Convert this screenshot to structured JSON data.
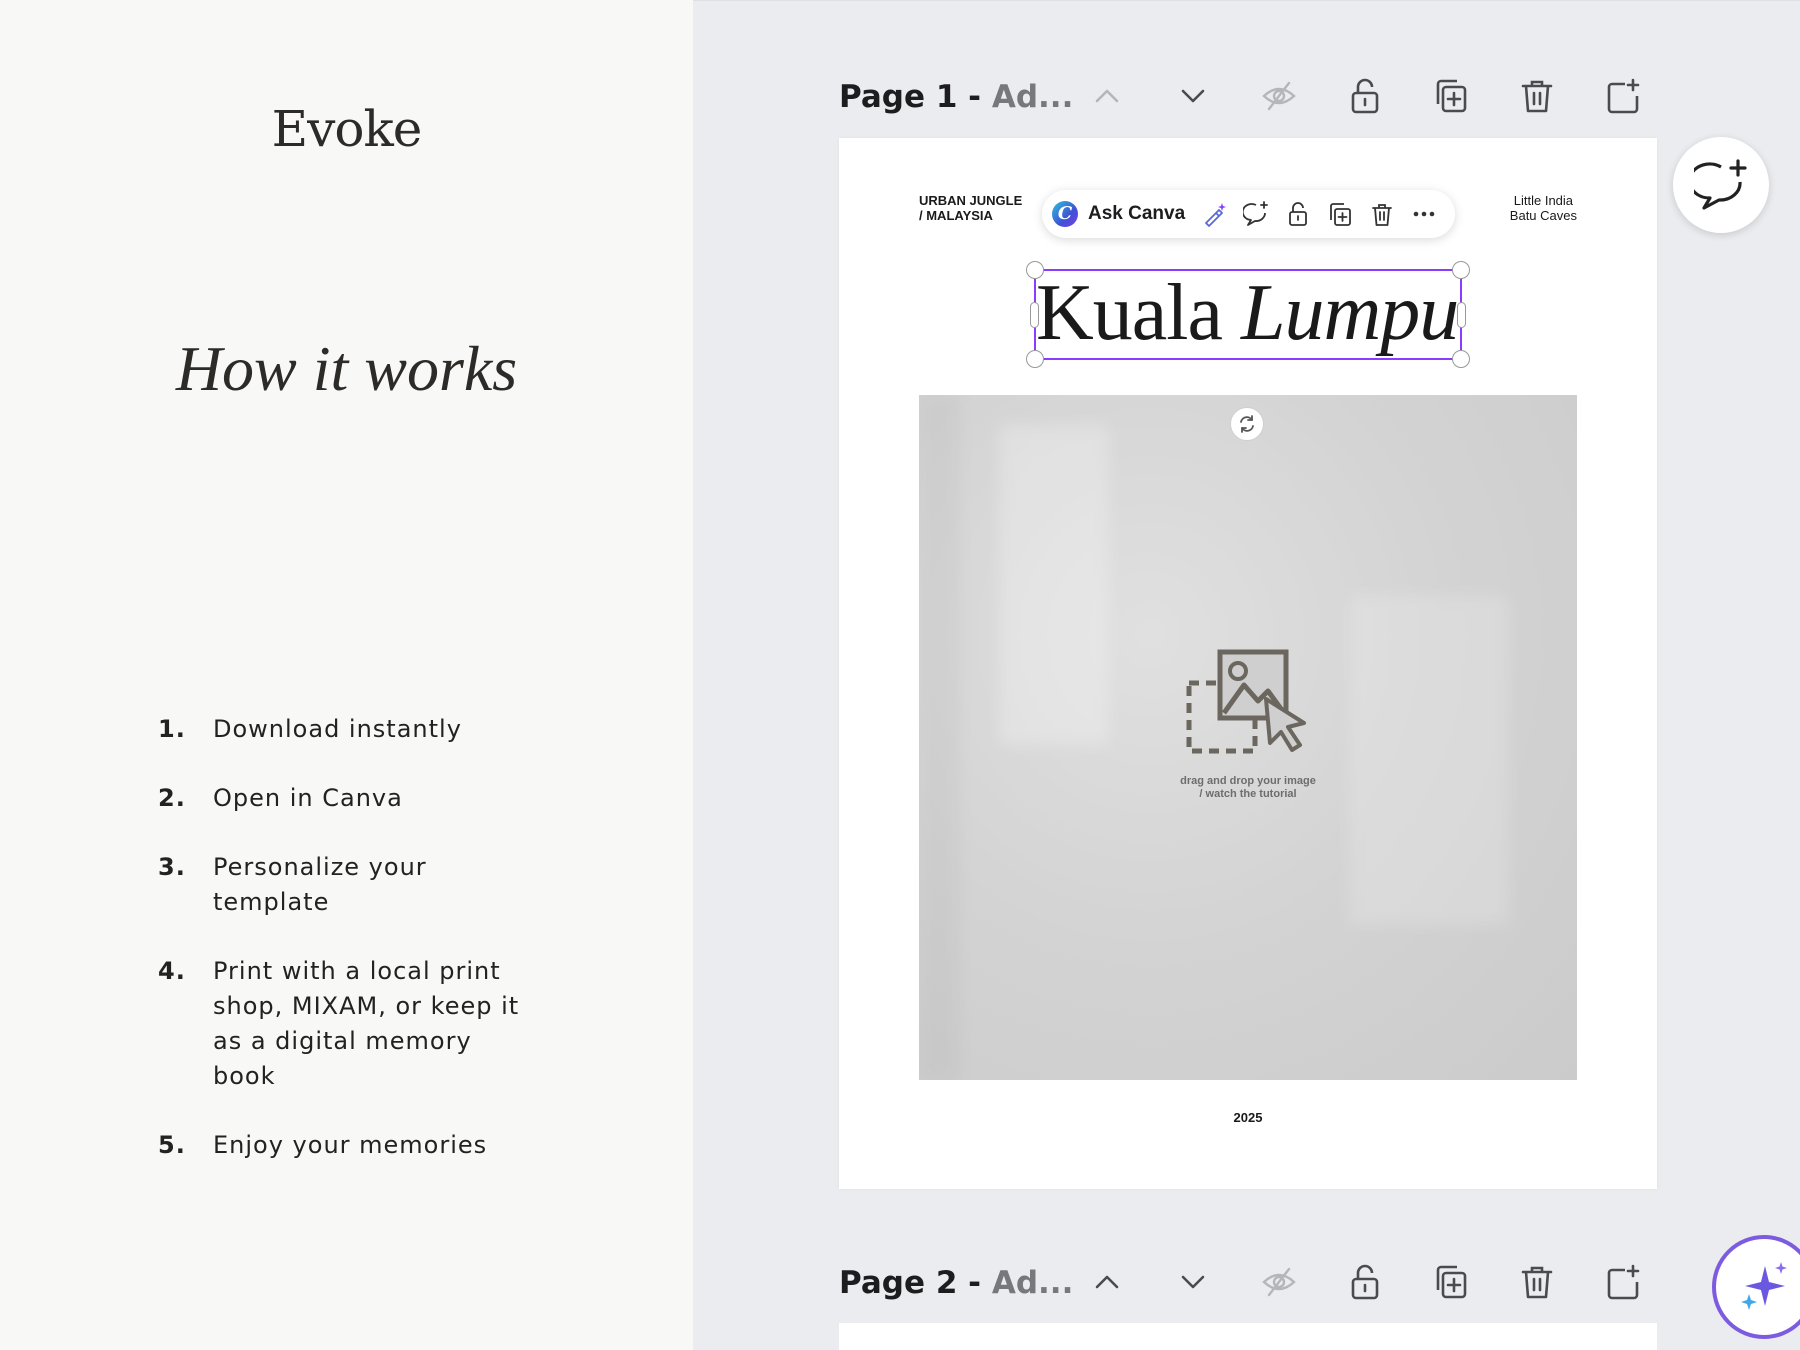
{
  "left_panel": {
    "brand": "Evoke",
    "title": "How it works",
    "steps": [
      {
        "num": "1.",
        "text": "Download instantly"
      },
      {
        "num": "2.",
        "text": "Open in Canva"
      },
      {
        "num": "3.",
        "text": "Personalize your template"
      },
      {
        "num": "4.",
        "text": "Print with a local print shop, MIXAM, or keep it as a digital memory book"
      },
      {
        "num": "5.",
        "text": "Enjoy your memories"
      }
    ]
  },
  "editor": {
    "page1": {
      "label_main": "Page 1 - ",
      "label_sub": "Ad...",
      "tag_left_line1": "URBAN JUNGLE",
      "tag_left_line2": "/ MALAYSIA",
      "tag_right_line1": "Little India",
      "tag_right_line2": "Batu Caves",
      "title_word1": "Kuala ",
      "title_word2": "Lumpur",
      "placeholder_line1": "drag and drop your image",
      "placeholder_line2": "/ watch the tutorial",
      "year": "2025"
    },
    "page2": {
      "label_main": "Page 2 - ",
      "label_sub": "Ad..."
    },
    "context_toolbar": {
      "ask_logo": "C",
      "ask_label": "Ask Canva"
    }
  },
  "icons": {
    "header_tools": [
      "chevron-up-icon",
      "chevron-down-icon",
      "eye-hidden-icon",
      "lock-icon",
      "duplicate-icon",
      "trash-icon",
      "add-page-icon"
    ],
    "context_tools": [
      "magic-edit-icon",
      "comment-add-icon",
      "lock-icon",
      "duplicate-icon",
      "trash-icon",
      "more-icon"
    ]
  },
  "colors": {
    "selection": "#8b3dff",
    "editor_bg": "#ebecef",
    "panel_bg": "#f8f8f6",
    "icon": "#4a4b4f",
    "icon_disabled": "#b5b6ba"
  }
}
